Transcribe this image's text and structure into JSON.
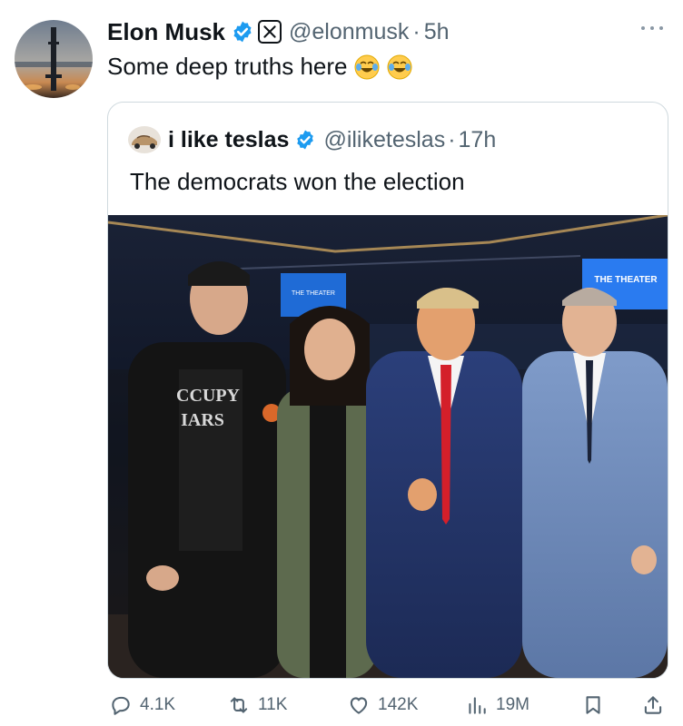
{
  "tweet": {
    "display_name": "Elon Musk",
    "handle": "@elonmusk",
    "separator": "·",
    "time": "5h",
    "text": "Some deep truths here",
    "avatar_icon": "starship-avatar",
    "emoji_icons": [
      "joy-emoji",
      "joy-emoji"
    ]
  },
  "quote": {
    "display_name": "i like teslas",
    "handle": "@iliketeslas",
    "separator": "·",
    "time": "17h",
    "text": "The democrats won the election",
    "avatar_icon": "car-avatar",
    "photo": {
      "description_icon": "group-photo",
      "sign_left": "THE THEATER",
      "sign_right": "THE THEATER",
      "shirt_text_line1": "CCUPY",
      "shirt_text_line2": "IARS"
    }
  },
  "actions": {
    "replies": "4.1K",
    "reposts": "11K",
    "likes": "142K",
    "views": "19M"
  },
  "colors": {
    "verified_blue": "#1d9bf0",
    "text_primary": "#0f1419",
    "text_secondary": "#536471",
    "border": "#cfd9de"
  }
}
